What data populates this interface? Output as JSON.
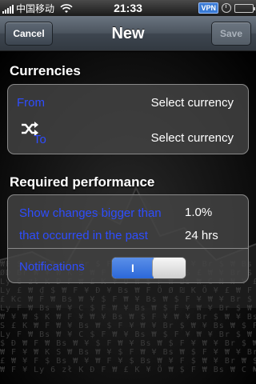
{
  "status_bar": {
    "carrier": "中国移动",
    "time": "21:33",
    "vpn": "VPN"
  },
  "nav": {
    "title": "New",
    "cancel_label": "Cancel",
    "save_label": "Save"
  },
  "currencies": {
    "header": "Currencies",
    "from_label": "From",
    "from_value": "Select currency",
    "to_label": "To",
    "to_value": "Select currency"
  },
  "performance": {
    "header": "Required performance",
    "changes_label": "Show changes bigger than",
    "changes_value": "1.0%",
    "period_label": "that occurred in the past",
    "period_value": "24 hrs",
    "notifications_label": "Notifications",
    "notifications_toggle_text": "I",
    "notifications_on": true
  },
  "colors": {
    "label_blue": "#2e4dff",
    "toggle_blue": "#2c68d9"
  },
  "icons": {
    "swap": "shuffle-icon",
    "wifi": "wifi-icon",
    "clock": "clock-icon",
    "battery": "battery-icon"
  }
}
